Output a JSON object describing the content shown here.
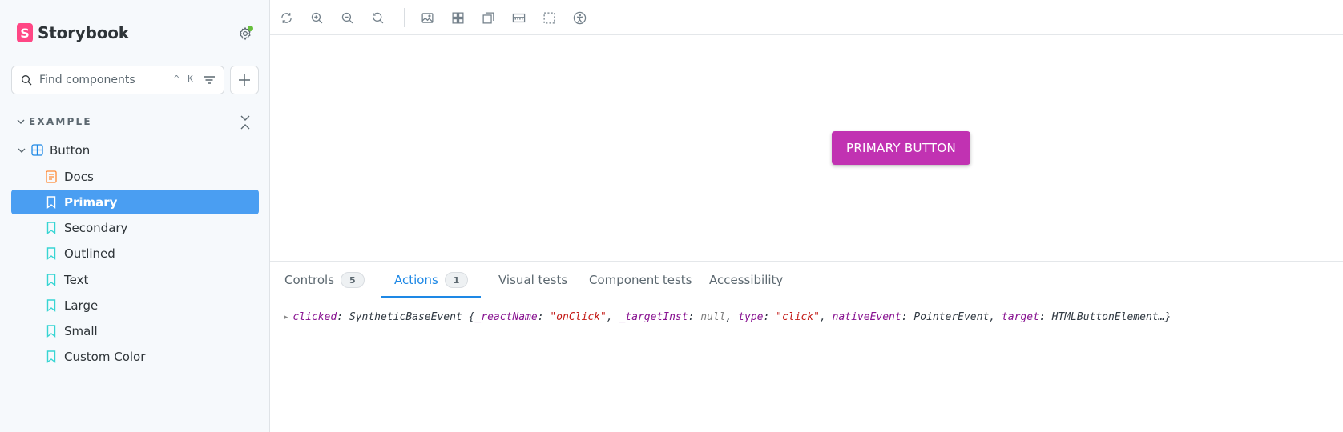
{
  "app": {
    "brand_logo_letter": "S",
    "brand_name": "Storybook"
  },
  "sidebar": {
    "search_placeholder": "Find components",
    "search_shortcut": "^ K",
    "group_label": "EXAMPLE",
    "component_label": "Button",
    "stories": [
      {
        "label": "Docs",
        "type": "docs"
      },
      {
        "label": "Primary",
        "type": "story",
        "selected": true
      },
      {
        "label": "Secondary",
        "type": "story"
      },
      {
        "label": "Outlined",
        "type": "story"
      },
      {
        "label": "Text",
        "type": "story"
      },
      {
        "label": "Large",
        "type": "story"
      },
      {
        "label": "Small",
        "type": "story"
      },
      {
        "label": "Custom Color",
        "type": "story"
      }
    ]
  },
  "toolbar": {
    "tools": [
      "reload-icon",
      "zoom-in-icon",
      "zoom-out-icon",
      "zoom-reset-icon",
      "background-icon",
      "grid-icon",
      "viewport-icon",
      "measure-icon",
      "outline-icon",
      "accessibility-icon"
    ]
  },
  "canvas": {
    "button_label": "PRIMARY BUTTON"
  },
  "panel": {
    "tabs": [
      {
        "label": "Controls",
        "count": "5"
      },
      {
        "label": "Actions",
        "count": "1",
        "active": true
      },
      {
        "label": "Visual tests"
      },
      {
        "label": "Component tests"
      },
      {
        "label": "Accessibility"
      }
    ],
    "log": {
      "event_name": "clicked",
      "event_type": "SyntheticBaseEvent",
      "props": [
        {
          "key": "_reactName",
          "value": "\"onClick\"",
          "kind": "string"
        },
        {
          "key": "_targetInst",
          "value": "null",
          "kind": "null"
        },
        {
          "key": "type",
          "value": "\"click\"",
          "kind": "string"
        },
        {
          "key": "nativeEvent",
          "value": "PointerEvent",
          "kind": "plain"
        },
        {
          "key": "target",
          "value": "HTMLButtonElement…",
          "kind": "plain"
        }
      ]
    }
  },
  "colors": {
    "accent": "#4a9ef2",
    "brand": "#ff4785",
    "primary_button": "#c132b2",
    "active_tab": "#1e88e5"
  }
}
